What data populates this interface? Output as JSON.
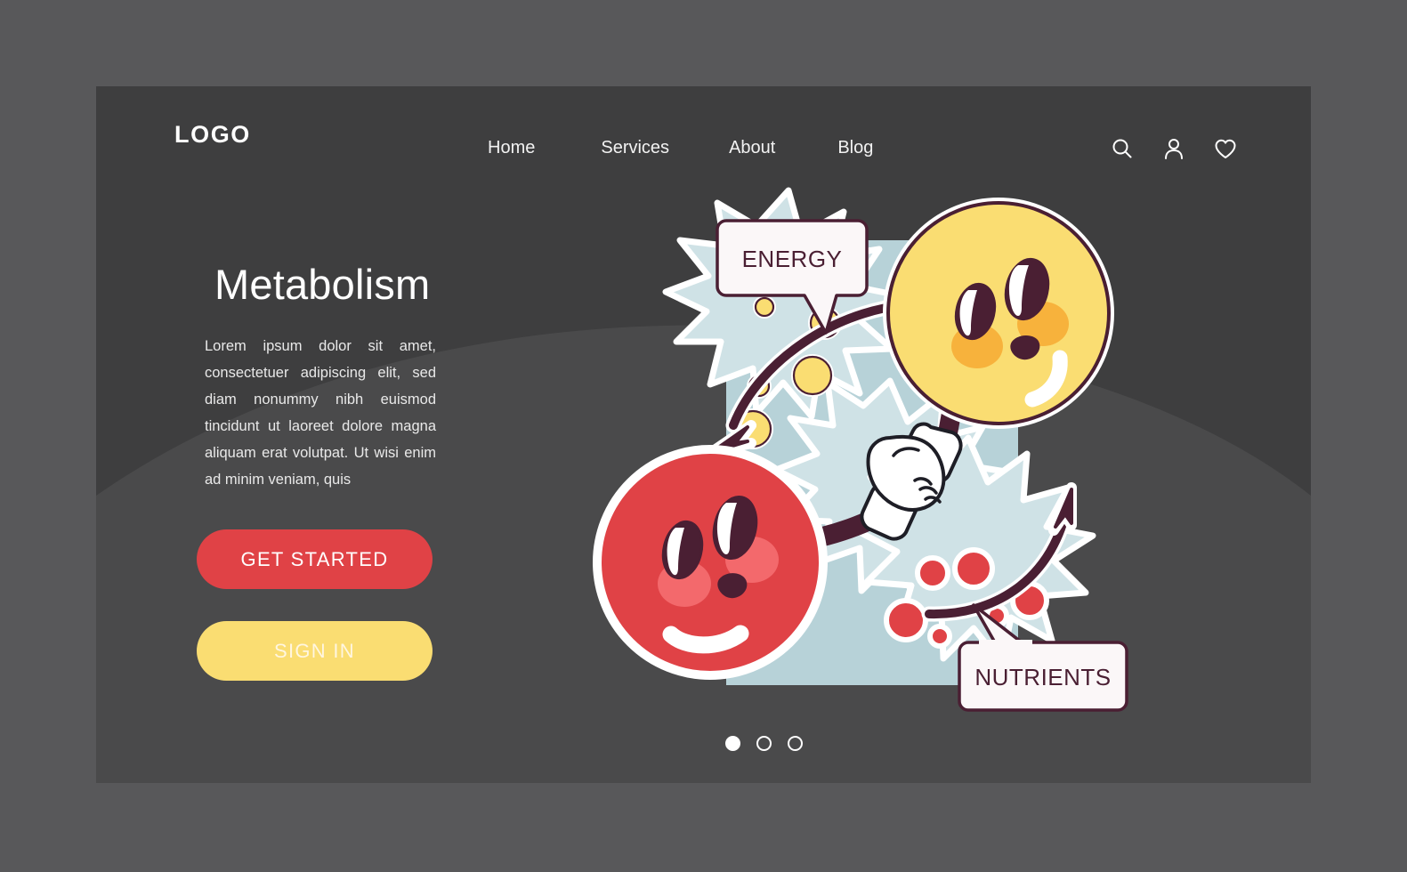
{
  "theme": {
    "page_bg": "#58585a",
    "card_bg": "#3e3e3f",
    "accent_red": "#e04246",
    "accent_yellow": "#fadd72",
    "ink": "#4a1f33",
    "panel_blue": "#b7d2d8",
    "text_light": "#ffffff"
  },
  "header": {
    "logo": "LOGO",
    "nav": [
      {
        "label": "Home"
      },
      {
        "label": "Services"
      },
      {
        "label": "About"
      },
      {
        "label": "Blog"
      }
    ],
    "icons": [
      {
        "name": "search-icon",
        "label": "Search"
      },
      {
        "name": "user-icon",
        "label": "Account"
      },
      {
        "name": "heart-icon",
        "label": "Favorites"
      }
    ]
  },
  "hero": {
    "title": "Metabolism",
    "body": "Lorem ipsum dolor sit amet, consectetuer adipiscing elit, sed diam nonummy nibh euismod tincidunt ut laoreet dolore magna aliquam erat volutpat. Ut wisi enim ad minim veniam, quis",
    "primary_button": "GET STARTED",
    "secondary_button": "SIGN IN"
  },
  "carousel": {
    "slides": [
      {
        "active": true
      },
      {
        "active": false
      },
      {
        "active": false
      }
    ],
    "current": 1,
    "total": 3
  },
  "illustration": {
    "alt": "Two smiling character faces shaking hands surrounded by energy and nutrient particles",
    "bubbles": [
      {
        "name": "energy-bubble",
        "label": "ENERGY"
      },
      {
        "name": "nutrients-bubble",
        "label": "NUTRIENTS"
      }
    ],
    "characters": [
      {
        "name": "yellow-face",
        "color": "#fadd72",
        "blush": "#f7b23c",
        "mouth": "smile"
      },
      {
        "name": "red-face",
        "color": "#e04246",
        "blush": "#f3696c",
        "mouth": "smile"
      }
    ],
    "particles": {
      "energy_color": "#fadd72",
      "nutrient_color": "#e04246"
    }
  }
}
